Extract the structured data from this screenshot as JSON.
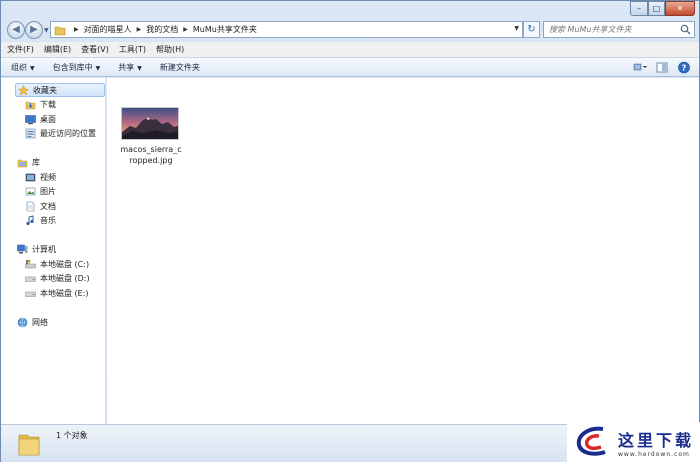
{
  "address": {
    "crumbs": [
      "对面的喵星人",
      "我的文档",
      "MuMu共享文件夹"
    ]
  },
  "search": {
    "placeholder": "搜索 MuMu共享文件夹"
  },
  "menu": [
    "文件(F)",
    "编辑(E)",
    "查看(V)",
    "工具(T)",
    "帮助(H)"
  ],
  "toolbar": {
    "organize": "组织",
    "include_in_library": "包含到库中",
    "share": "共享",
    "new_folder": "新建文件夹"
  },
  "nav": {
    "favorites": {
      "label": "收藏夹",
      "items": [
        "下载",
        "桌面",
        "最近访问的位置"
      ]
    },
    "libraries": {
      "label": "库",
      "items": [
        "视频",
        "图片",
        "文档",
        "音乐"
      ]
    },
    "computer": {
      "label": "计算机",
      "items": [
        "本地磁盘 (C:)",
        "本地磁盘 (D:)",
        "本地磁盘 (E:)"
      ]
    },
    "network": {
      "label": "网络"
    }
  },
  "files": [
    {
      "name": "macos_sierra_cropped.jpg"
    }
  ],
  "status": {
    "count_text": "1 个对象"
  },
  "watermark": {
    "text": "这里下载",
    "url": "www.herdown.com"
  },
  "colors": {
    "accent": "#3a6fb0",
    "selection": "#cfe3fb",
    "watermark": "#1a2d8c"
  }
}
